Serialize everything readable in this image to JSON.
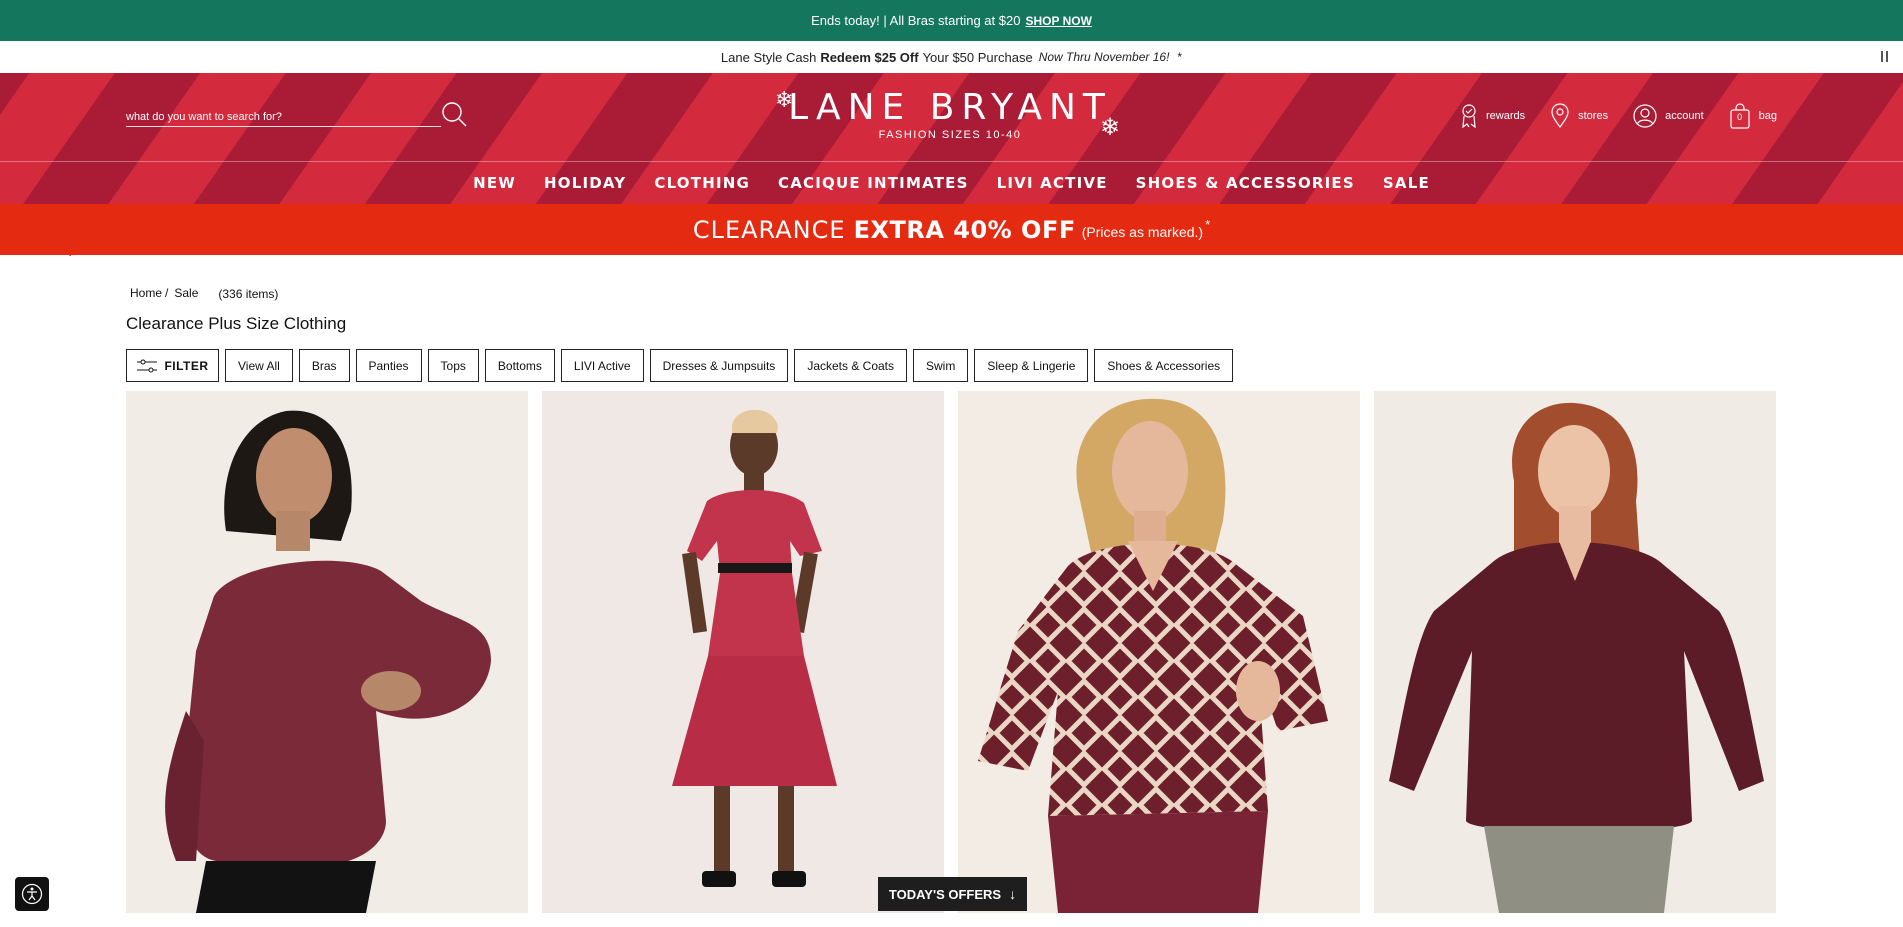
{
  "promo_top": {
    "text": "Ends today! | All Bras starting at $20",
    "link": "SHOP NOW"
  },
  "cash_bar": {
    "lead": "Lane Style Cash",
    "bold": "Redeem $25 Off",
    "tail": "Your $50 Purchase",
    "italic": "Now Thru November 16!",
    "asterisk": "*"
  },
  "header": {
    "search_placeholder": "what do you want to search for?",
    "logo": {
      "name": "LANE BRYANT",
      "tagline": "FASHION SIZES 10-40"
    },
    "utility": {
      "rewards": "rewards",
      "stores": "stores",
      "account": "account",
      "bag": "bag",
      "bag_count": "0"
    },
    "nav": [
      "NEW",
      "HOLIDAY",
      "CLOTHING",
      "CACIQUE INTIMATES",
      "LIVI ACTIVE",
      "SHOES & ACCESSORIES",
      "SALE"
    ]
  },
  "clearance": {
    "lite": "CLEARANCE",
    "bold": "EXTRA 40% OFF",
    "note": "(Prices as marked.)",
    "star": "*"
  },
  "breadcrumb": {
    "home": "Home",
    "sep": "/",
    "current": "Sale",
    "count": "(336 items)"
  },
  "page_title": "Clearance Plus Size Clothing",
  "filter_label": "FILTER",
  "chips": [
    "View All",
    "Bras",
    "Panties",
    "Tops",
    "Bottoms",
    "LIVI Active",
    "Dresses & Jumpsuits",
    "Jackets & Coats",
    "Swim",
    "Sleep & Lingerie",
    "Shoes & Accessories"
  ],
  "todays_offers": "TODAY'S OFFERS",
  "colors": {
    "promo_green": "#15765e",
    "header_red": "#d42a3e",
    "header_dark": "#aa1c35",
    "clearance_red": "#e52a12",
    "burgundy": "#7a2a38"
  }
}
